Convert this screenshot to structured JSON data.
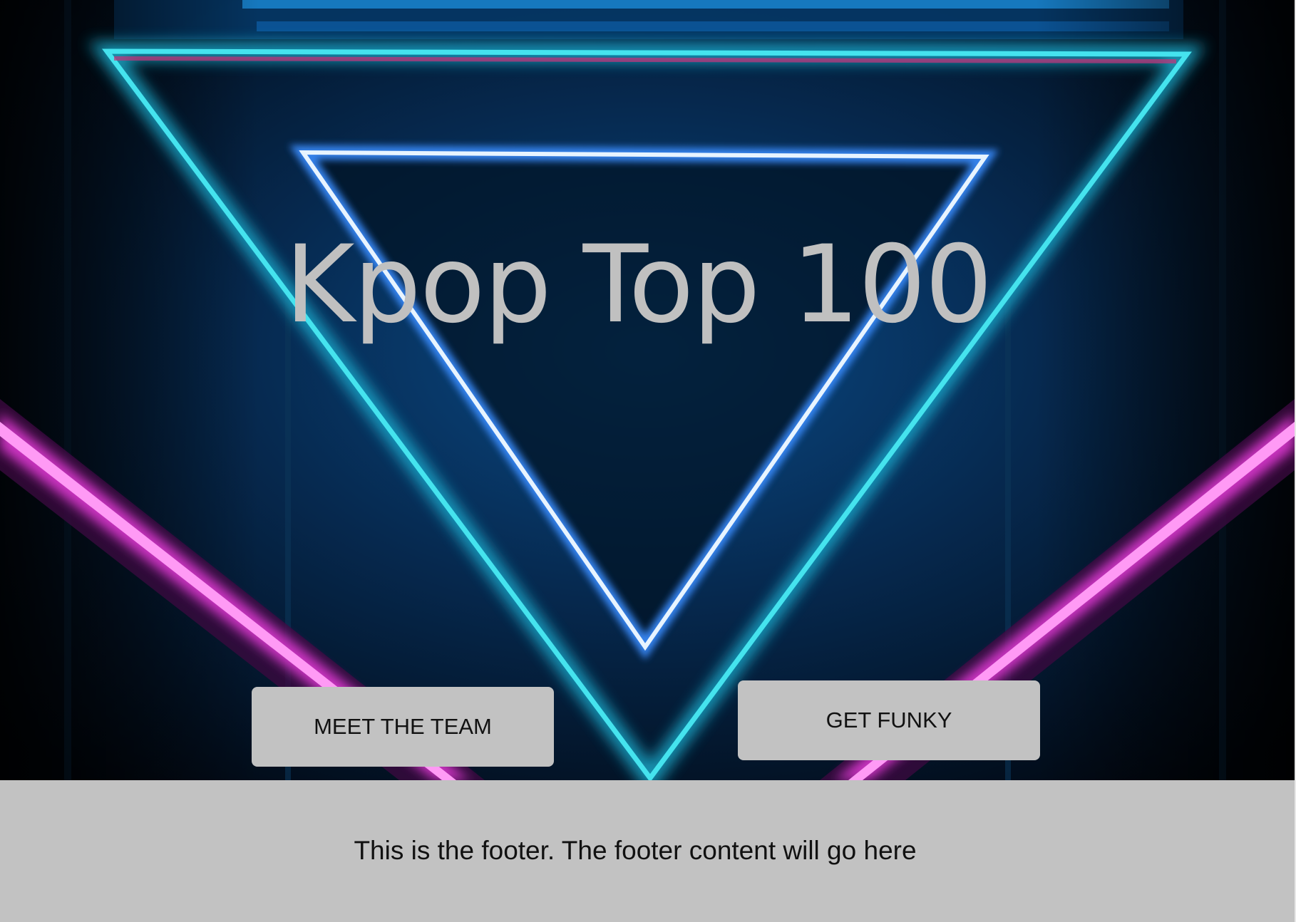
{
  "hero": {
    "title": "Kpop Top 100",
    "background_image": "neon-triangle-photo",
    "colors": {
      "neon_cyan": "#25d6e6",
      "neon_white_blue": "#d8f0ff",
      "neon_magenta": "#e63bd9",
      "dark_blue": "#04203d",
      "background": "#020a16"
    }
  },
  "buttons": {
    "meet_the_team": "MEET THE TEAM",
    "get_funky": "GET FUNKY"
  },
  "footer": {
    "text": "This is the footer. The footer content will go here"
  },
  "colors": {
    "title_text": "#c0c0c0",
    "button_bg": "#c2c2c2",
    "footer_bg": "#c2c2c2",
    "dark_text": "#111111"
  }
}
